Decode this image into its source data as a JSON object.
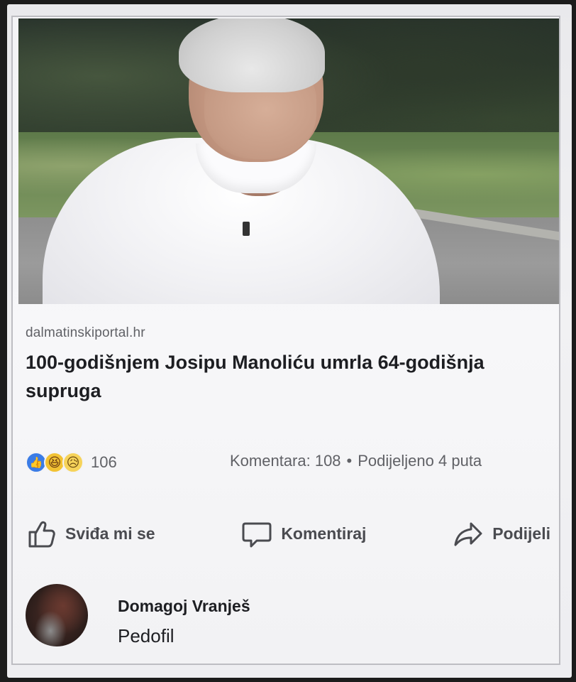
{
  "post": {
    "image_alt": "elderly man in white shirt outdoors",
    "link_domain": "dalmatinskiportal.hr",
    "headline": "100-godišnjem Josipu Manoliću umrla 64-godišnja supruga"
  },
  "reactions": {
    "icons": [
      "like-icon",
      "haha-icon",
      "sad-icon"
    ],
    "count": "106"
  },
  "stats": {
    "comments": "Komentara: 108",
    "separator": "•",
    "shares": "Podijeljeno 4 puta"
  },
  "actions": {
    "like": "Sviđa mi se",
    "comment": "Komentiraj",
    "share": "Podijeli"
  },
  "comment": {
    "author": "Domagoj Vranješ",
    "text": "Pedofil"
  },
  "colors": {
    "like_blue": "#3b7ce6",
    "text_dark": "#1d1e22",
    "text_muted": "#606166"
  }
}
